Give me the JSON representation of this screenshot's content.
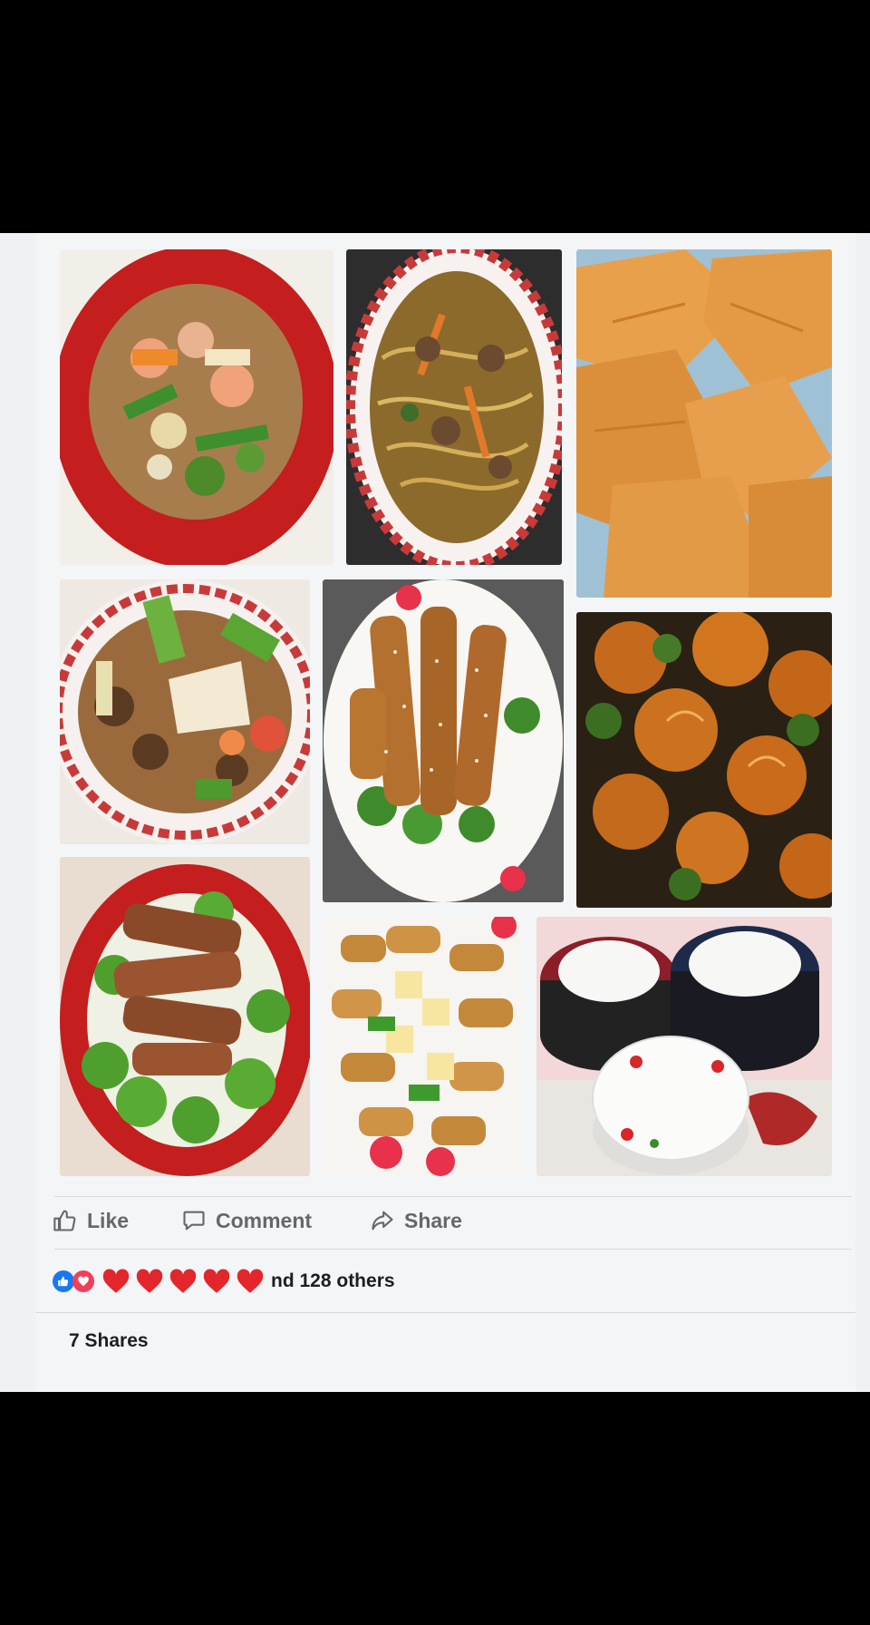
{
  "post": {
    "photos": [
      {
        "name": "shrimp-vegetables-photo"
      },
      {
        "name": "lo-mein-photo"
      },
      {
        "name": "fried-wontons-photo"
      },
      {
        "name": "pepper-steak-photo"
      },
      {
        "name": "sesame-chicken-photo"
      },
      {
        "name": "general-tso-chicken-photo"
      },
      {
        "name": "teriyaki-chicken-broccoli-photo"
      },
      {
        "name": "sweet-sour-chicken-photo"
      },
      {
        "name": "plates-stack-photo"
      }
    ],
    "actions": {
      "like_label": "Like",
      "comment_label": "Comment",
      "share_label": "Share"
    },
    "reactions": {
      "icons": [
        "like-icon",
        "love-icon"
      ],
      "text": "nd 128 others"
    },
    "shares_text": "7 Shares"
  },
  "colors": {
    "like_blue": "#1877f2",
    "love_red": "#f33e58",
    "action_gray": "#65676b"
  }
}
